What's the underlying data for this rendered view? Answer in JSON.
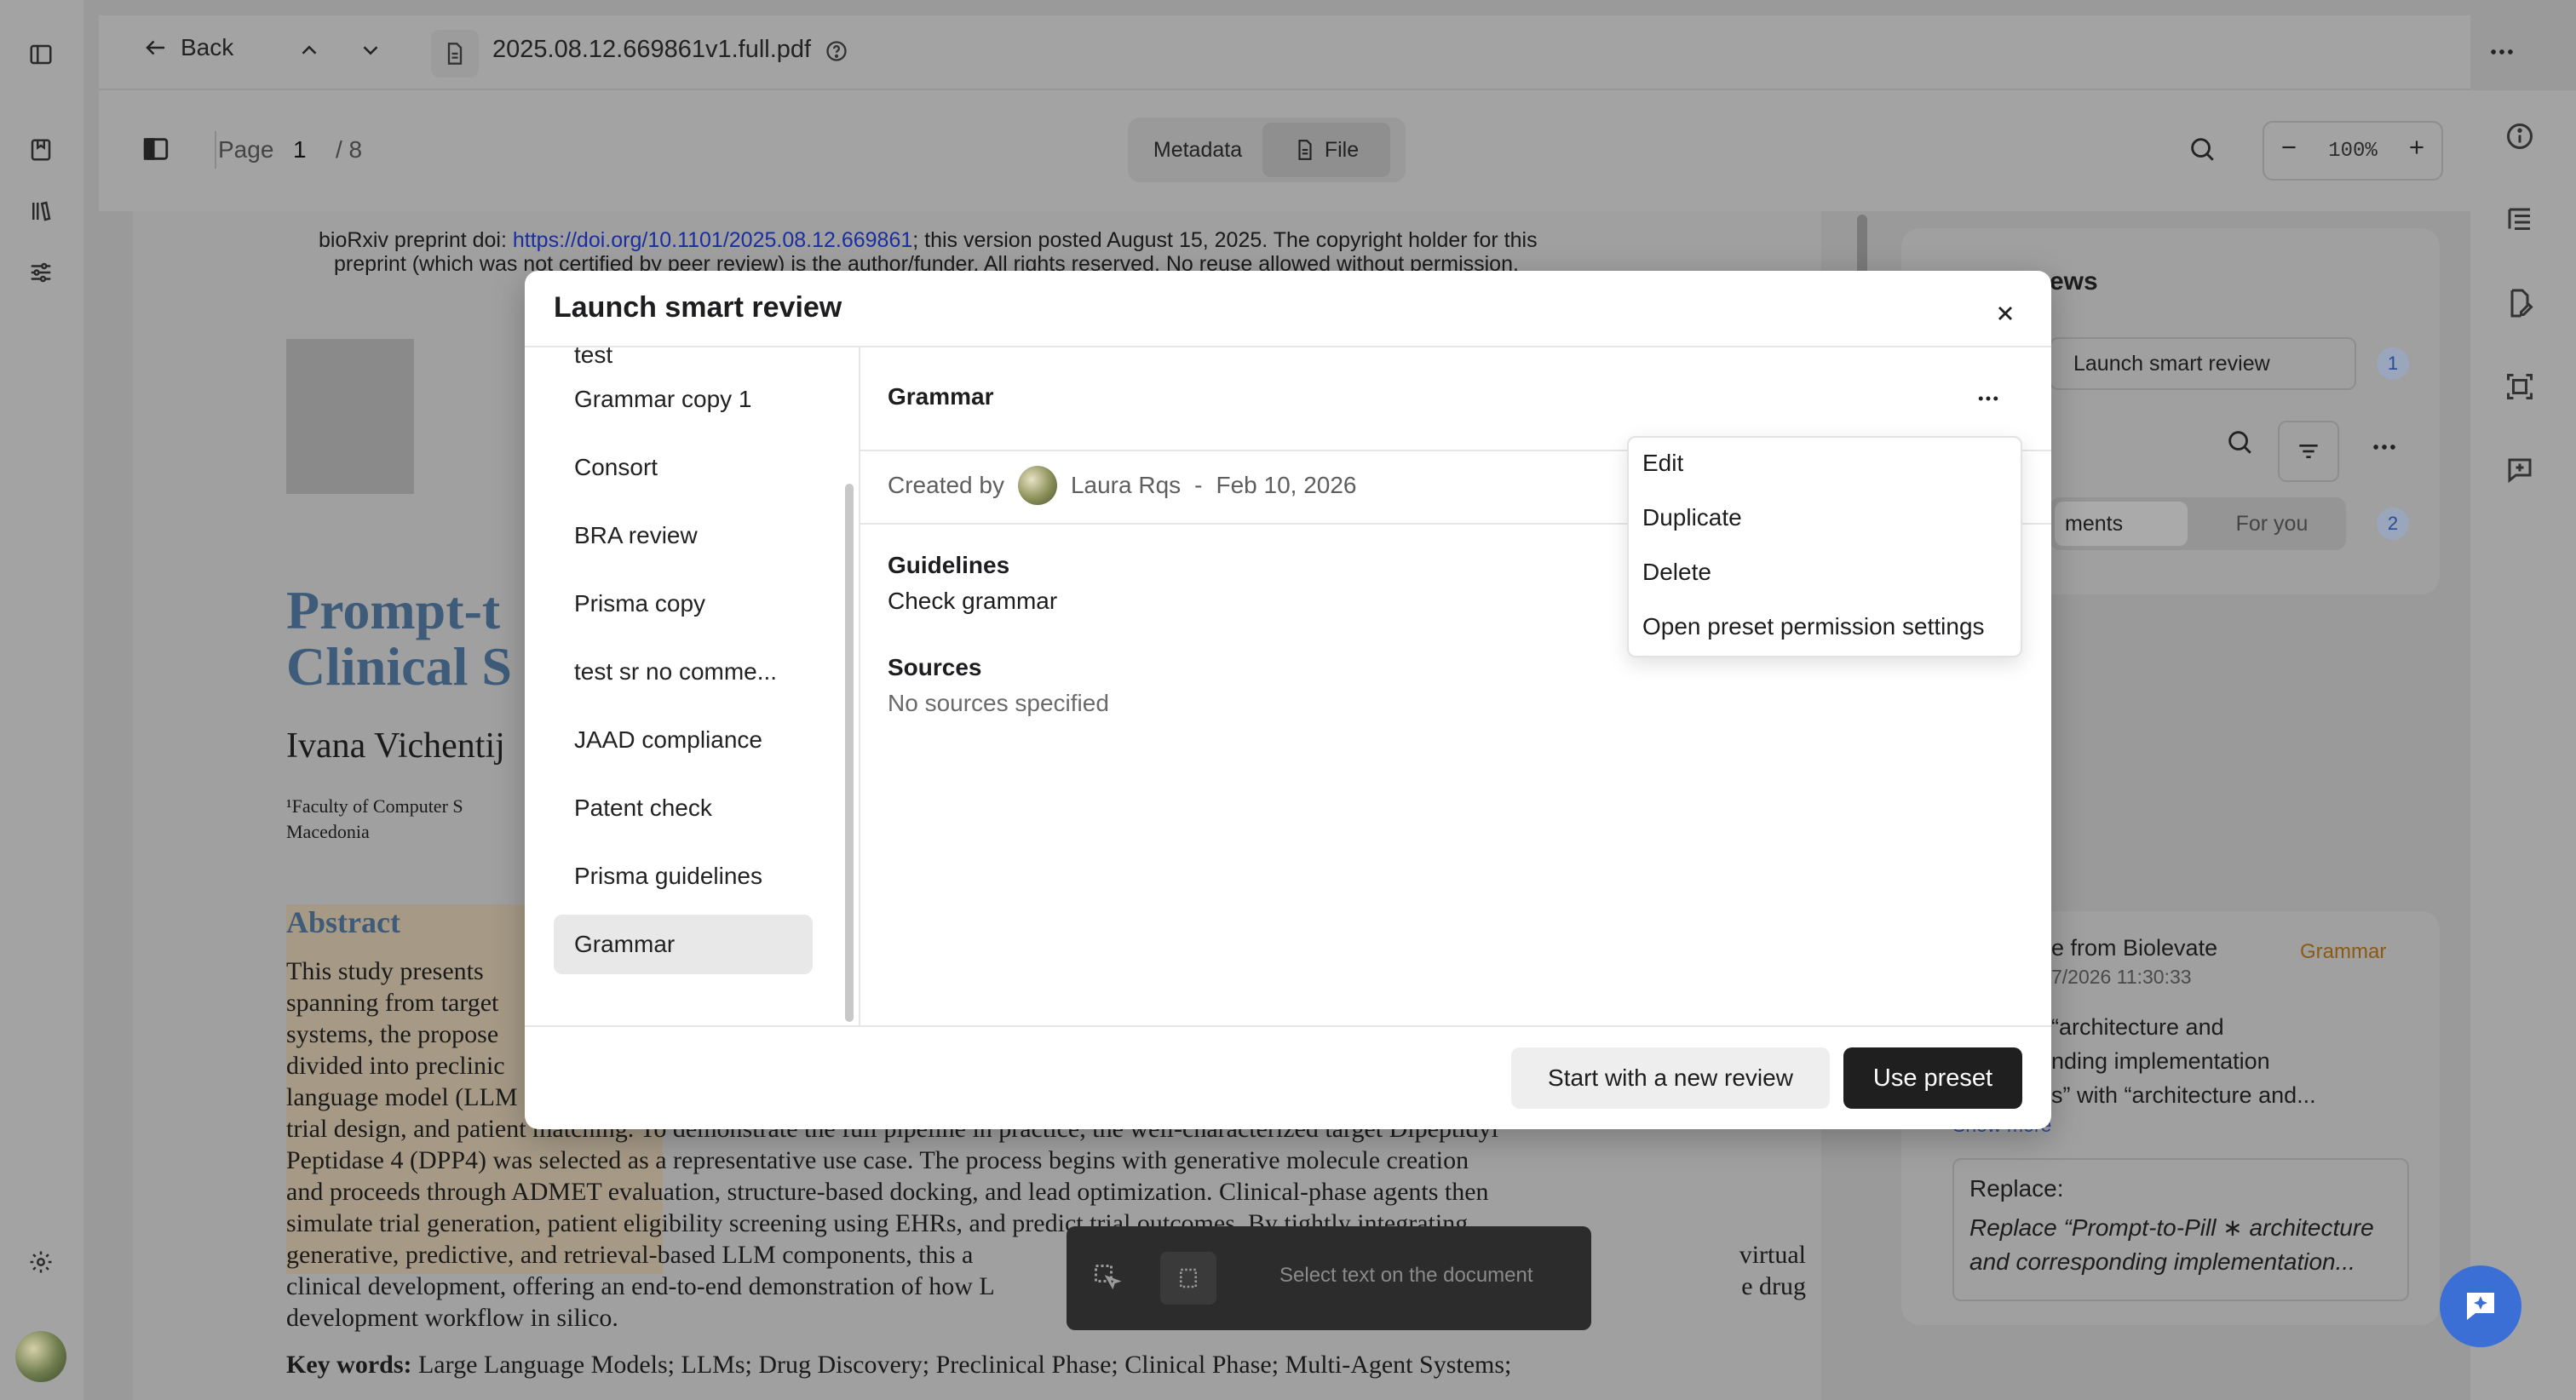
{
  "toolbar": {
    "back_label": "Back",
    "filename": "2025.08.12.669861v1.full.pdf",
    "page_label": "Page",
    "page_current": "1",
    "page_total": "/ 8",
    "tab_metadata": "Metadata",
    "tab_file": "File",
    "zoom": "100%"
  },
  "document": {
    "header_line1_a": "bioRxiv preprint doi: ",
    "header_link": "https://doi.org/10.1101/2025.08.12.669861",
    "header_line1_b": "; this version posted August 15, 2025. The copyright holder for this",
    "header_line2": "preprint (which was not certified by peer review) is the author/funder. All rights reserved. No reuse allowed without permission.",
    "title_l1": "Prompt-t",
    "title_l2": "Clinical S",
    "author": "Ivana Vichentij",
    "affil_l1": "¹Faculty of Computer S",
    "affil_l2": "Macedonia",
    "abstract_heading": "Abstract",
    "abs_l1": "This study presents",
    "abs_l2": "spanning from target",
    "abs_l3": "systems, the propose",
    "abs_l4": "divided into preclinic",
    "abs_l5": "language model (LLM",
    "abs_l6": "trial design, and patient matching. To demonstrate the full pipeline in practice, the well-characterized target Dipeptidyl",
    "abs_l7": "Peptidase 4 (DPP4) was selected as a representative use case. The process begins with generative molecule creation",
    "abs_l8": "and proceeds through ADMET evaluation, structure-based docking, and lead optimization. Clinical-phase agents then",
    "abs_l9": "simulate trial generation, patient eligibility screening using EHRs, and predict trial outcomes. By tightly integrating",
    "abs_l10": "generative, predictive, and retrieval-based LLM components, this a",
    "abs_l10b": "virtual",
    "abs_l11": "clinical development, offering an end-to-end demonstration of how L",
    "abs_l11b": "e drug",
    "abs_l12": "development workflow in silico.",
    "keywords_label": "Key words:",
    "keywords": " Large Language Models; LLMs; Drug Discovery; Preclinical Phase; Clinical Phase; Multi-Agent Systems;"
  },
  "right_panel": {
    "title_fragment": "ews",
    "launch_label": "Launch smart review",
    "launch_count": "1",
    "tab_comments": "ments",
    "tab_for_you": "For you",
    "for_you_count": "2",
    "card_source": "e from Biolevate",
    "card_badge": "Grammar",
    "card_time": "7/2026 11:30:33",
    "card_l1": "“architecture and",
    "card_l2": "nding implementation",
    "card_l3": "s” with “architecture and...",
    "show_more": "Show more",
    "replace_label": "Replace:",
    "replace_l1": "Replace “Prompt-to-Pill ∗ architecture",
    "replace_l2": "and corresponding implementation..."
  },
  "modal": {
    "title": "Launch smart review",
    "presets": [
      {
        "label": "test"
      },
      {
        "label": "Grammar copy 1"
      },
      {
        "label": "Consort"
      },
      {
        "label": "BRA review"
      },
      {
        "label": "Prisma copy"
      },
      {
        "label": "test sr no comme..."
      },
      {
        "label": "JAAD compliance"
      },
      {
        "label": "Patent check"
      },
      {
        "label": "Prisma guidelines"
      },
      {
        "label": "Grammar"
      }
    ],
    "selected_name": "Grammar",
    "created_by_label": "Created by",
    "author": "Laura Rqs",
    "separator": "-",
    "date": "Feb 10, 2026",
    "guidelines_heading": "Guidelines",
    "guidelines_value": "Check grammar",
    "sources_heading": "Sources",
    "sources_value": "No sources specified",
    "btn_new_review": "Start with a new review",
    "btn_use_preset": "Use preset"
  },
  "menu": {
    "items": [
      {
        "label": "Edit"
      },
      {
        "label": "Duplicate"
      },
      {
        "label": "Delete"
      },
      {
        "label": "Open preset permission settings"
      }
    ]
  },
  "selection_bar": {
    "hint": "Select text on the document"
  },
  "colors": {
    "primary_button": "#1f1f1f",
    "accent_blue": "#3b6fd6",
    "badge_orange": "#c98a3a",
    "overlay": "#9a9a9a"
  }
}
